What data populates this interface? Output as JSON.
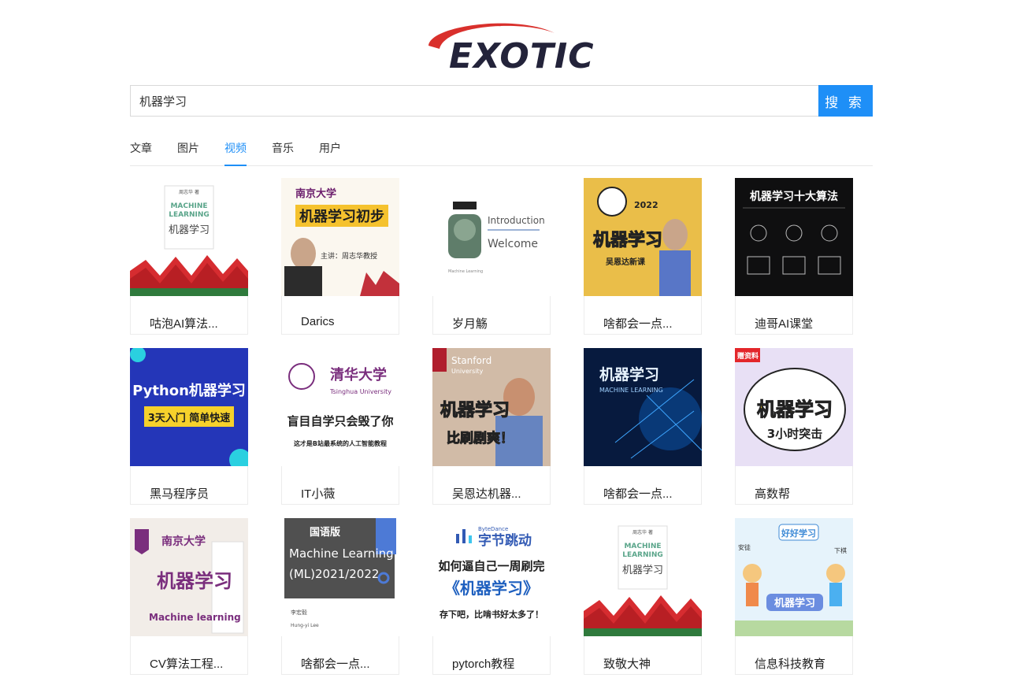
{
  "logo": {
    "text": "EXOTIC",
    "accent": "#d9302c",
    "color": "#23233a"
  },
  "search": {
    "value": "机器学习",
    "button_label": "搜 索",
    "button_color": "#1e8ff7"
  },
  "tabs": [
    {
      "label": "文章",
      "active": false
    },
    {
      "label": "图片",
      "active": false
    },
    {
      "label": "视频",
      "active": true
    },
    {
      "label": "音乐",
      "active": false
    },
    {
      "label": "用户",
      "active": false
    }
  ],
  "videos": [
    {
      "author": "咕泡AI算法...",
      "thumb": {
        "style": "watermelon",
        "lines": [
          "周志华 著",
          "MACHINE",
          "LEARNING",
          "机器学习"
        ]
      }
    },
    {
      "author": "Darics",
      "thumb": {
        "style": "nju-lecture",
        "lines": [
          "南京大学",
          "机器学习初步",
          "主讲：周志华教授"
        ]
      }
    },
    {
      "author": "岁月觞",
      "thumb": {
        "style": "intro",
        "lines": [
          "Introduction",
          "Welcome",
          "Machine Learning"
        ]
      }
    },
    {
      "author": "啥都会一点...",
      "thumb": {
        "style": "purple-2022",
        "lines": [
          "2022",
          "机器学习",
          "吴恩达新课"
        ]
      }
    },
    {
      "author": "迪哥AI课堂",
      "thumb": {
        "style": "dark-algo",
        "lines": [
          "机器学习十大算法"
        ]
      }
    },
    {
      "author": "黑马程序员",
      "thumb": {
        "style": "python",
        "lines": [
          "Python机器学习",
          "3天入门 简单快速"
        ]
      }
    },
    {
      "author": "IT小薇",
      "thumb": {
        "style": "tsinghua",
        "lines": [
          "清华大学",
          "Tsinghua University",
          "盲目自学只会毁了你",
          "这才是B站最系统的人工智能教程"
        ]
      }
    },
    {
      "author": "吴恩达机器...",
      "thumb": {
        "style": "stanford",
        "lines": [
          "Stanford",
          "University",
          "机器学习",
          "比刷剧爽！"
        ]
      }
    },
    {
      "author": "啥都会一点...",
      "thumb": {
        "style": "blue-net",
        "lines": [
          "机器学习",
          "MACHINE LEARNING"
        ]
      }
    },
    {
      "author": "高数帮",
      "thumb": {
        "style": "burst",
        "lines": [
          "赠资料",
          "机器学习",
          "3小时突击"
        ]
      }
    },
    {
      "author": "CV算法工程...",
      "thumb": {
        "style": "nju-book",
        "lines": [
          "南京大学",
          "机器学习",
          "Machine learning"
        ]
      }
    },
    {
      "author": "啥都会一点...",
      "thumb": {
        "style": "ml-2021",
        "lines": [
          "国语版",
          "Machine Learning",
          "(ML)2021/2022",
          "李宏毅",
          "Hung-yi Lee"
        ]
      }
    },
    {
      "author": "pytorch教程",
      "thumb": {
        "style": "bytedance",
        "lines": [
          "ByteDance",
          "字节跳动",
          "如何逼自己一周刷完",
          "《机器学习》",
          "存下吧，比啃书好太多了！"
        ]
      }
    },
    {
      "author": "致敬大神",
      "thumb": {
        "style": "watermelon",
        "lines": [
          "周志华 著",
          "MACHINE",
          "LEARNING",
          "机器学习"
        ]
      }
    },
    {
      "author": "信息科技教育",
      "thumb": {
        "style": "cartoon",
        "lines": [
          "好好学习",
          "机器学习",
          "安徒",
          "下棋"
        ]
      }
    }
  ]
}
